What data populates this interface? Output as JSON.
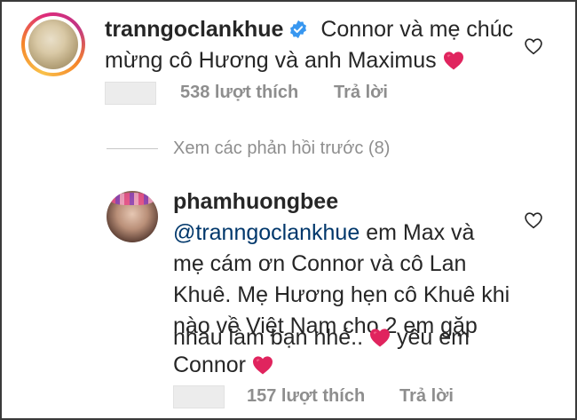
{
  "comment1": {
    "username": "tranngoclankhue",
    "text_line1": "Connor và mẹ chúc",
    "text_line2": "mừng cô Hương và anh Maximus",
    "likes": "538 lượt thích",
    "reply_label": "Trả lời"
  },
  "view_replies": {
    "label": "Xem các phản hồi trước (8)"
  },
  "comment2": {
    "username": "phamhuongbee",
    "mention": "@tranngoclankhue",
    "text_line1": " em Max và",
    "text_line2": "mẹ cám ơn Connor và cô Lan",
    "text_line3": "Khuê. Mẹ Hương hẹn cô Khuê khi",
    "text_line4": "nào về Việt Nam cho 2 em gặp",
    "text_line5a": "nhau làm bạn nhé..",
    "text_line5b": " yêu em",
    "text_line6": "Connor",
    "likes": "157 lượt thích",
    "reply_label": "Trả lời"
  },
  "colors": {
    "verified_badge": "#3897f0",
    "heart": "#e0245e",
    "secondary_text": "#8e8e8e",
    "mention": "#00376b"
  },
  "icons": {
    "verified": "verified-badge-icon",
    "like": "heart-outline-icon",
    "emoji": "red-heart-emoji"
  }
}
